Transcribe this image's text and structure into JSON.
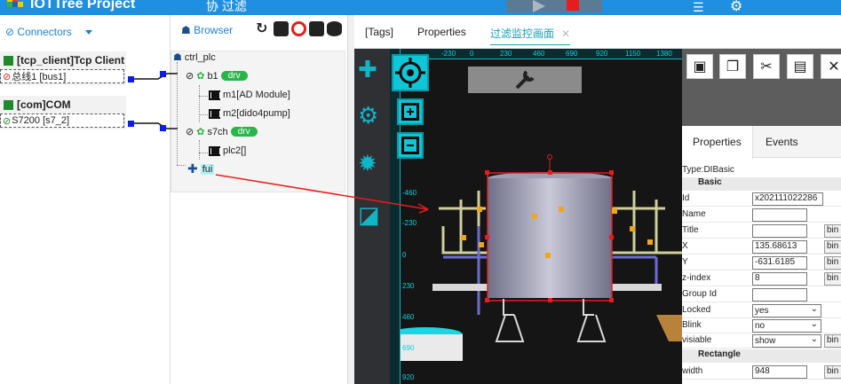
{
  "topbar": {
    "title": "IOTTree Project",
    "subtitle": "协 过滤",
    "server_icon": "server-icon",
    "settings_icon": "gears-icon"
  },
  "connectors": {
    "header": "Connectors",
    "blocks": [
      {
        "title": "[tcp_client]Tcp Client",
        "bus": "总线1 [bus1]",
        "bus_icon": "broken-link-icon"
      },
      {
        "title": "[com]COM",
        "bus": "S7200 [s7_2]",
        "bus_icon": "link-icon"
      }
    ]
  },
  "browser": {
    "header": "Browser",
    "root": "ctrl_plc",
    "nodes": [
      {
        "label": "b1",
        "badge": "drv"
      },
      {
        "label": "m1[AD Module]"
      },
      {
        "label": "m2[dido4pump]"
      },
      {
        "label": "s7ch",
        "badge": "drv"
      },
      {
        "label": "plc2[]"
      },
      {
        "label": "fui"
      }
    ]
  },
  "editor": {
    "tabs": [
      "[Tags]",
      "Properties",
      "过滤监控画面"
    ],
    "ruler_h": [
      "-230",
      "0",
      "230",
      "460",
      "690",
      "920",
      "1150",
      "1380"
    ],
    "ruler_v": [
      "-460",
      "-230",
      "0",
      "230",
      "460",
      "690",
      "920"
    ]
  },
  "properties": {
    "tabs": [
      "Properties",
      "Events"
    ],
    "type": "Type:DIBasic",
    "section_basic": "Basic",
    "section_rect": "Rectangle",
    "bind_label": "bin",
    "rows": [
      {
        "label": "Id",
        "value": "x202111022286"
      },
      {
        "label": "Name",
        "value": ""
      },
      {
        "label": "Title",
        "value": ""
      },
      {
        "label": "X",
        "value": "135.68613"
      },
      {
        "label": "Y",
        "value": "-631.6185"
      },
      {
        "label": "z-index",
        "value": "8"
      },
      {
        "label": "Group Id",
        "value": ""
      },
      {
        "label": "Locked",
        "value": "yes"
      },
      {
        "label": "Blink",
        "value": "no"
      },
      {
        "label": "visiable",
        "value": "show"
      }
    ],
    "width_label": "width",
    "width_value": "948"
  },
  "colors": {
    "topbar": "#1e8fe1",
    "accent": "#0fb6c8",
    "badge": "#28b54a",
    "selection": "#e81c1c",
    "port": "#0b1ee6"
  }
}
